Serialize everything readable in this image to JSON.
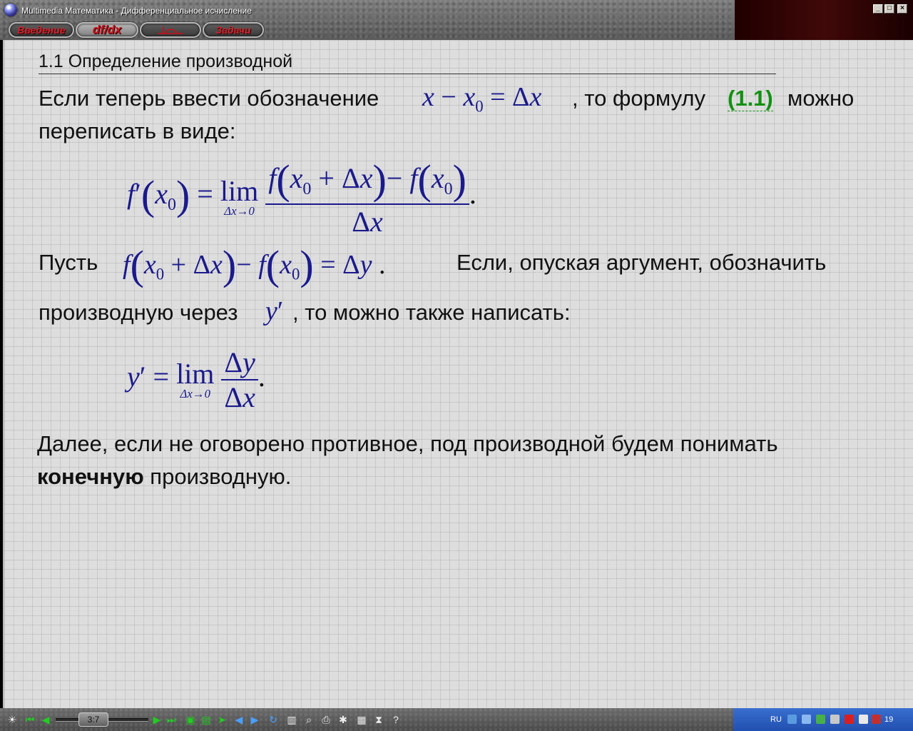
{
  "window": {
    "title": "Multimedia Математика - Дифференциальное исчисление",
    "min": "_",
    "max": "□",
    "close": "×"
  },
  "tabs": {
    "intro": "Введение",
    "dfdx": "df/dx",
    "tasks": "Задачи"
  },
  "content": {
    "section_title": "1.1 Определение производной",
    "p1_start": "Если теперь ввести обозначение",
    "p1_mid": ", то формулу",
    "p1_ref": "(1.1)",
    "p1_end": "можно",
    "p1_line2": "переписать в виде:",
    "p2_start": "Пусть",
    "p2_mid": "Если, опуская аргумент, обозначить",
    "p3_start": "производную через",
    "p3_end": ",  то можно также написать:",
    "p4_line1": "Далее, если не оговорено противное, под производной будем понимать",
    "p4_bold": "конечную",
    "p4_rest": "производную."
  },
  "bottom": {
    "page": "3:7",
    "tray_lang": "RU",
    "tray_clock": "19"
  },
  "colors": {
    "math": "#1a1a8c",
    "link": "#119011",
    "tab_text": "#d0222a"
  }
}
